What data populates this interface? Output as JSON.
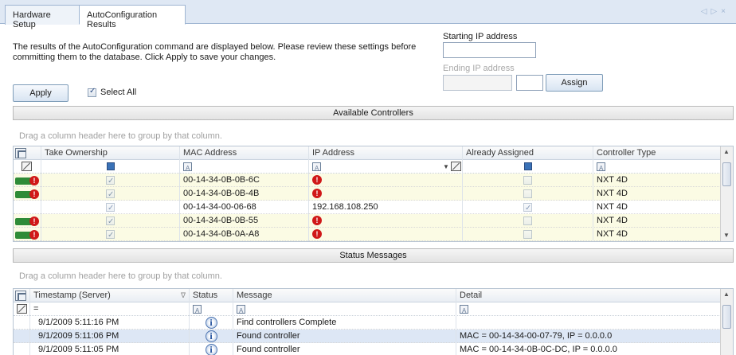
{
  "tabs": [
    {
      "label": "Hardware Setup"
    },
    {
      "label": "AutoConfiguration Results"
    }
  ],
  "intro": {
    "line1": "The results of the AutoConfiguration command are displayed below.  Please review these settings before",
    "line2": "committing them to the database.  Click Apply to save your changes."
  },
  "apply_label": "Apply",
  "select_all": {
    "label": "Select All",
    "checked": true
  },
  "ip_range": {
    "start_label": "Starting IP address",
    "end_label": "Ending IP address",
    "assign_label": "Assign"
  },
  "controllers": {
    "section_title": "Available Controllers",
    "drag_hint": "Drag a column header here to group by that column.",
    "columns": [
      "Take Ownership",
      "MAC Address",
      "IP Address",
      "Already Assigned",
      "Controller Type"
    ],
    "rows": [
      {
        "status": "error",
        "take": true,
        "mac": "00-14-34-0B-0B-6C",
        "ip": "",
        "ip_error": true,
        "assigned": false,
        "type": "NXT 4D",
        "highlight": "yellow"
      },
      {
        "status": "error",
        "take": true,
        "mac": "00-14-34-0B-0B-4B",
        "ip": "",
        "ip_error": true,
        "assigned": false,
        "type": "NXT 4D",
        "highlight": "yellow"
      },
      {
        "status": "none",
        "take": true,
        "mac": "00-14-34-00-06-68",
        "ip": "192.168.108.250",
        "ip_error": false,
        "assigned": true,
        "type": "NXT 4D",
        "highlight": "none"
      },
      {
        "status": "error",
        "take": true,
        "mac": "00-14-34-0B-0B-55",
        "ip": "",
        "ip_error": true,
        "assigned": false,
        "type": "NXT 4D",
        "highlight": "yellow"
      },
      {
        "status": "error",
        "take": true,
        "mac": "00-14-34-0B-0A-A8",
        "ip": "",
        "ip_error": true,
        "assigned": false,
        "type": "NXT 4D",
        "highlight": "yellow"
      }
    ]
  },
  "messages": {
    "section_title": "Status Messages",
    "drag_hint": "Drag a column header here to group by that column.",
    "columns": [
      "Timestamp (Server)",
      "Status",
      "Message",
      "Detail"
    ],
    "filter_eq": "=",
    "rows": [
      {
        "timestamp": "9/1/2009 5:11:16 PM",
        "status": "info",
        "message": "Find controllers Complete",
        "detail": "",
        "highlight": "none"
      },
      {
        "timestamp": "9/1/2009 5:11:06 PM",
        "status": "info",
        "message": "Found controller",
        "detail": "MAC = 00-14-34-00-07-79, IP = 0.0.0.0",
        "highlight": "blue"
      },
      {
        "timestamp": "9/1/2009 5:11:05 PM",
        "status": "info",
        "message": "Found controller",
        "detail": "MAC = 00-14-34-0B-0C-DC, IP = 0.0.0.0",
        "highlight": "none"
      }
    ]
  },
  "icons": {
    "error": "error-icon",
    "info": "info-icon",
    "ok": "green-status-icon",
    "column_chooser": "column-chooser-icon",
    "clear_filter": "clear-filter-icon"
  },
  "colors": {
    "highlight_yellow": "#fbfbe4",
    "highlight_blue": "#dde7f5",
    "error_red": "#d01818",
    "ok_green": "#2e8b37"
  }
}
